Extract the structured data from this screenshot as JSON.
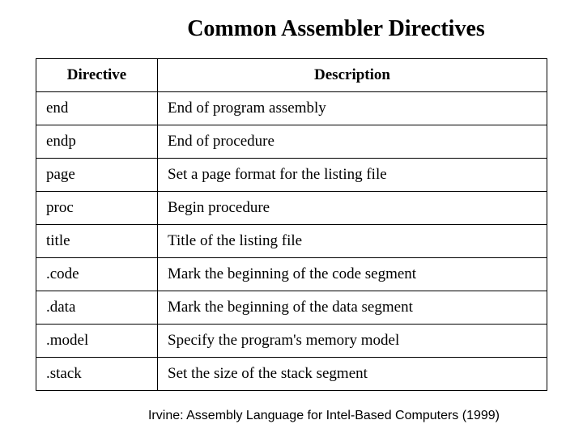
{
  "title": "Common Assembler Directives",
  "headers": {
    "directive": "Directive",
    "description": "Description"
  },
  "rows": [
    {
      "directive": "end",
      "description": "End of program assembly"
    },
    {
      "directive": "endp",
      "description": "End of procedure"
    },
    {
      "directive": "page",
      "description": "Set a page format for the listing file"
    },
    {
      "directive": "proc",
      "description": "Begin procedure"
    },
    {
      "directive": "title",
      "description": "Title of the listing file"
    },
    {
      "directive": ".code",
      "description": "Mark the beginning of the code segment"
    },
    {
      "directive": ".data",
      "description": "Mark the beginning of the data segment"
    },
    {
      "directive": ".model",
      "description": "Specify the program's memory model"
    },
    {
      "directive": ".stack",
      "description": "Set the size of the stack segment"
    }
  ],
  "footer": "Irvine: Assembly Language for Intel-Based Computers (1999)"
}
